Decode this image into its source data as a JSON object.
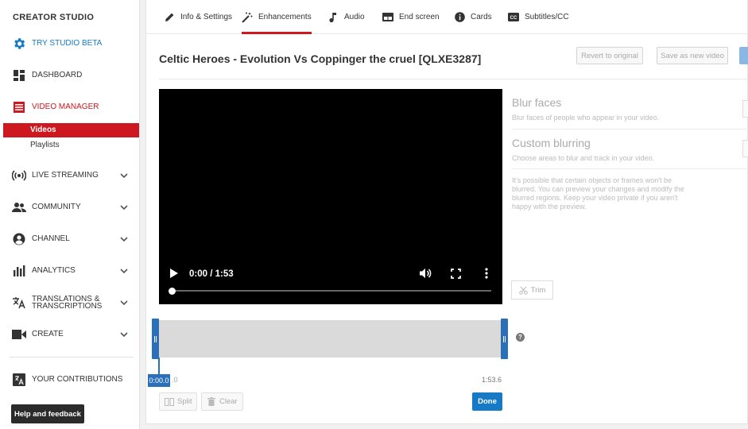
{
  "sidebar": {
    "title": "CREATOR STUDIO",
    "items": [
      {
        "label": "TRY STUDIO BETA",
        "icon": "gear-icon"
      },
      {
        "label": "DASHBOARD",
        "icon": "dashboard-icon"
      },
      {
        "label": "VIDEO MANAGER",
        "icon": "video-manager-icon"
      },
      {
        "label": "LIVE STREAMING",
        "icon": "live-streaming-icon"
      },
      {
        "label": "COMMUNITY",
        "icon": "community-icon"
      },
      {
        "label": "CHANNEL",
        "icon": "channel-icon"
      },
      {
        "label": "ANALYTICS",
        "icon": "analytics-icon"
      },
      {
        "label": "TRANSLATIONS & TRANSCRIPTIONS",
        "icon": "translate-icon"
      },
      {
        "label": "CREATE",
        "icon": "create-icon"
      },
      {
        "label": "YOUR CONTRIBUTIONS",
        "icon": "contributions-icon"
      }
    ],
    "sub_items": [
      {
        "label": "Videos",
        "active": true
      },
      {
        "label": "Playlists",
        "active": false
      }
    ],
    "help_label": "Help and feedback"
  },
  "tabs": [
    {
      "label": "Info & Settings",
      "icon": "pencil-icon"
    },
    {
      "label": "Enhancements",
      "icon": "magic-wand-icon",
      "active": true
    },
    {
      "label": "Audio",
      "icon": "music-note-icon"
    },
    {
      "label": "End screen",
      "icon": "end-screen-icon"
    },
    {
      "label": "Cards",
      "icon": "info-icon"
    },
    {
      "label": "Subtitles/CC",
      "icon": "cc-icon"
    }
  ],
  "video": {
    "title": "Celtic Heroes - Evolution Vs Coppinger the cruel [QLXE3287]",
    "time_display": "0:00 / 1:53"
  },
  "header_buttons": {
    "revert": "Revert to original",
    "save_new": "Save as new video"
  },
  "options": {
    "blur_faces": {
      "title": "Blur faces",
      "desc": "Blur faces of people who appear in your video."
    },
    "custom_blur": {
      "title": "Custom blurring",
      "desc": "Choose areas to blur and track in your video."
    },
    "note": "It's possible that certain objects or frames won't be blurred. You can preview your changes and modify the blurred regions. Keep your video private if you aren't happy with the preview.",
    "trim_label": "Trim"
  },
  "timeline": {
    "start_time": "0:00.0",
    "zero_label": ".0",
    "end_time": "1:53.6",
    "help": "?",
    "split_label": "Split",
    "clear_label": "Clear",
    "done_label": "Done"
  },
  "colors": {
    "accent_red": "#cc181e",
    "accent_blue": "#167ac6",
    "timeline_blue": "#2a6fb7"
  }
}
